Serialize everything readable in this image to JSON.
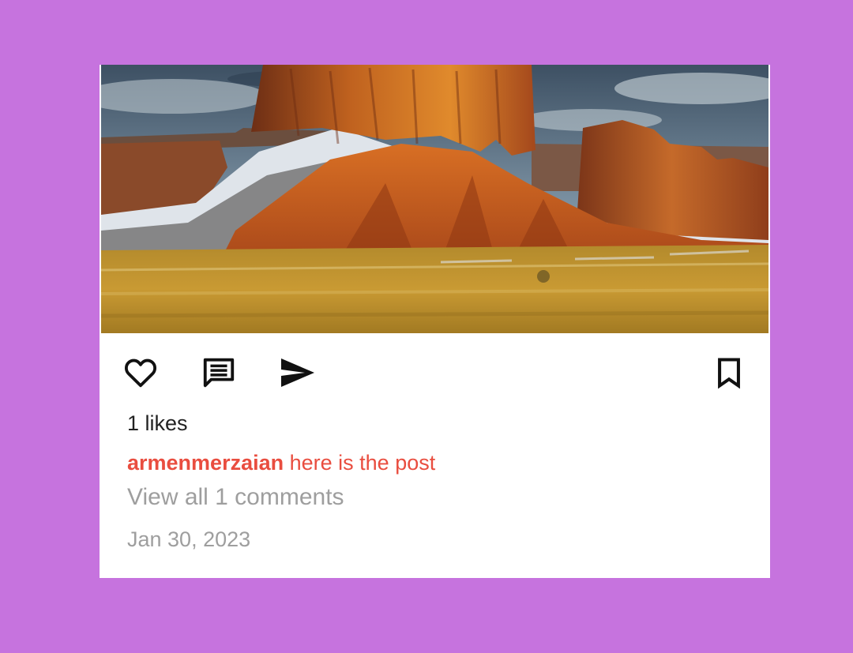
{
  "colors": {
    "background": "#c673de",
    "card": "#ffffff",
    "accent": "#e94d3f",
    "muted": "#9e9e9e",
    "text": "#222222"
  },
  "post": {
    "image": "desert-butte-landscape-photo",
    "actions": {
      "like": "heart-outline-icon",
      "comment": "comment-icon",
      "share": "send-icon",
      "save": "bookmark-outline-icon"
    },
    "likes": "1 likes",
    "username": "armenmerzaian",
    "caption": "here is the post",
    "view_comments": "View all 1 comments",
    "date": "Jan 30, 2023"
  }
}
